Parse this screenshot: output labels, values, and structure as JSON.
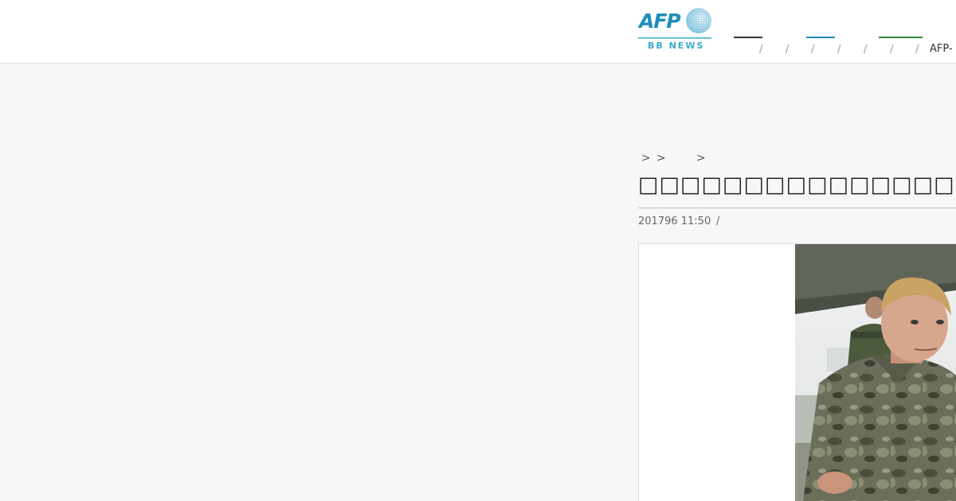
{
  "header": {
    "logo": {
      "icon": "afp-globe-logo",
      "wordmark": "AFP",
      "subtitle": "BB NEWS"
    },
    "nav": {
      "separators": [
        "/",
        "/",
        "/",
        "/",
        "/",
        "/",
        "/"
      ],
      "last_link": "AFP-"
    },
    "colors": {
      "brand_blue": "#1b8fb8",
      "accent_green": "#2e8b3d",
      "logo_subtitle": "#3aa9cf"
    }
  },
  "breadcrumb": {
    "separators": [
      ">",
      ">",
      ">"
    ]
  },
  "article": {
    "headline": "□□□□□□□□□□□□□□□□□□□□□□□□ □",
    "date": "201796 11:50",
    "date_separator": "/",
    "photo": {
      "description_icon": "man-in-camouflage-jacket-photo"
    }
  }
}
